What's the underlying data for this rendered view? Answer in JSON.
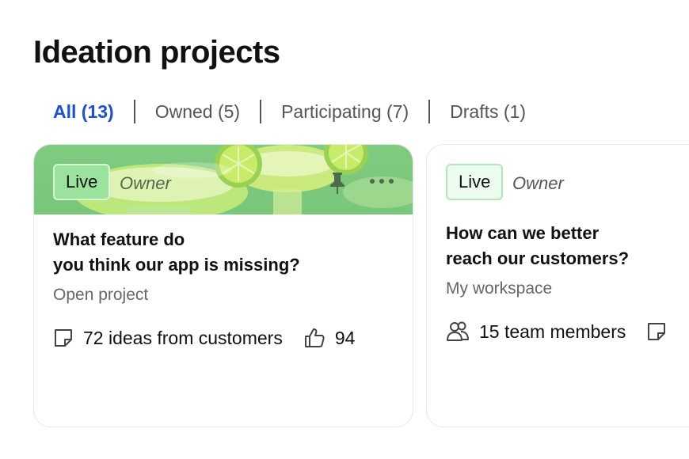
{
  "page": {
    "title": "Ideation projects"
  },
  "tabs": [
    {
      "label": "All (13)",
      "active": true
    },
    {
      "label": "Owned (5)",
      "active": false
    },
    {
      "label": "Participating (7)",
      "active": false
    },
    {
      "label": "Drafts (1)",
      "active": false
    }
  ],
  "cards": [
    {
      "status": "Live",
      "role": "Owner",
      "title_line1": "What feature do",
      "title_line2": "you think our app is missing?",
      "subtitle": "Open project",
      "ideas": "72 ideas from customers",
      "likes": "94",
      "banner_color": "#7fcb7f",
      "badge_color": "#9be39d"
    },
    {
      "status": "Live",
      "role": "Owner",
      "title_line1": "How can we better",
      "title_line2": "reach our customers?",
      "subtitle": "My workspace",
      "members": "15 team members",
      "badge_color": "#ecfcef"
    }
  ],
  "colors": {
    "accent": "#1a4fe0",
    "text": "#111111",
    "muted": "#666666"
  }
}
